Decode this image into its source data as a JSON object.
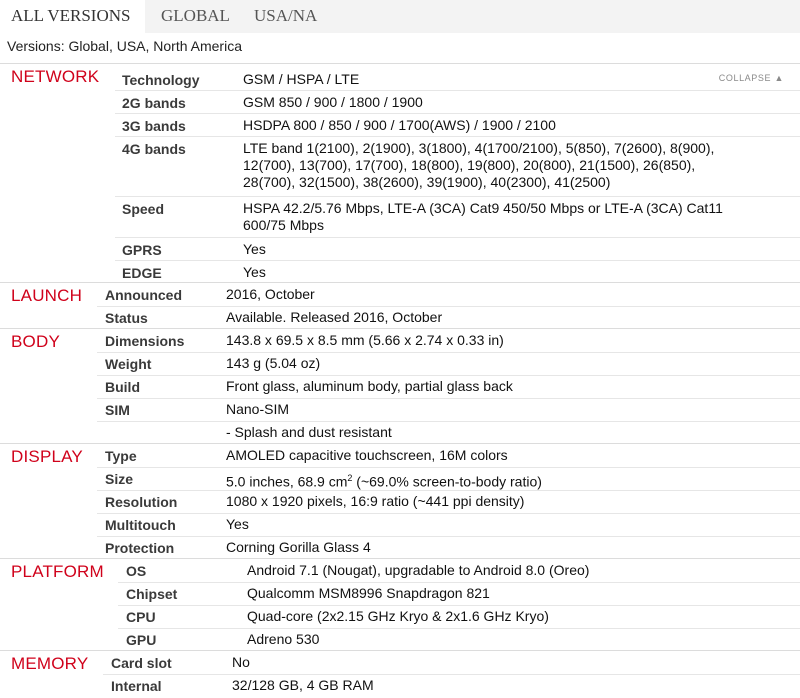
{
  "tabs": [
    {
      "label": "ALL VERSIONS",
      "active": true
    },
    {
      "label": "GLOBAL",
      "active": false
    },
    {
      "label": "USA/NA",
      "active": false
    }
  ],
  "versions_text": "Versions: Global, USA, North America",
  "collapse_label": "COLLAPSE",
  "collapse_icon": "triangle-up-icon",
  "accent_color": "#d0021b",
  "network": {
    "title": "NETWORK",
    "technology": {
      "label": "Technology",
      "value": "GSM / HSPA / LTE"
    },
    "bands2g": {
      "label": "2G bands",
      "value": "GSM 850 / 900 / 1800 / 1900"
    },
    "bands3g": {
      "label": "3G bands",
      "value": "HSDPA 800 / 850 / 900 / 1700(AWS) / 1900 / 2100"
    },
    "bands4g": {
      "label": "4G bands",
      "line1": "LTE band 1(2100), 2(1900), 3(1800), 4(1700/2100), 5(850), 7(2600), 8(900),",
      "line2": "12(700), 13(700), 17(700), 18(800), 19(800), 20(800), 21(1500), 26(850),",
      "line3": "28(700), 32(1500), 38(2600), 39(1900), 40(2300), 41(2500)"
    },
    "speed": {
      "label": "Speed",
      "line1": "HSPA 42.2/5.76 Mbps, LTE-A (3CA) Cat9 450/50 Mbps or LTE-A (3CA) Cat11",
      "line2": "600/75 Mbps"
    },
    "gprs": {
      "label": "GPRS",
      "value": "Yes"
    },
    "edge": {
      "label": "EDGE",
      "value": "Yes"
    }
  },
  "launch": {
    "title": "LAUNCH",
    "announced": {
      "label": "Announced",
      "value": "2016, October"
    },
    "status": {
      "label": "Status",
      "value": "Available. Released 2016, October"
    }
  },
  "body": {
    "title": "BODY",
    "dimensions": {
      "label": "Dimensions",
      "value": "143.8 x 69.5 x 8.5 mm (5.66 x 2.74 x 0.33 in)"
    },
    "weight": {
      "label": "Weight",
      "value": "143 g (5.04 oz)"
    },
    "build": {
      "label": "Build",
      "value": "Front glass, aluminum body, partial glass back"
    },
    "sim": {
      "label": "SIM",
      "value": "Nano-SIM"
    },
    "extra": {
      "value": "- Splash and dust resistant"
    }
  },
  "display": {
    "title": "DISPLAY",
    "type": {
      "label": "Type",
      "value": "AMOLED capacitive touchscreen, 16M colors"
    },
    "size": {
      "label": "Size",
      "value_pre": "5.0 inches, 68.9 cm",
      "value_sup": "2",
      "value_post": " (~69.0% screen-to-body ratio)"
    },
    "resolution": {
      "label": "Resolution",
      "value": "1080 x 1920 pixels, 16:9 ratio (~441 ppi density)"
    },
    "multitouch": {
      "label": "Multitouch",
      "value": "Yes"
    },
    "protection": {
      "label": "Protection",
      "value": "Corning Gorilla Glass 4"
    }
  },
  "platform": {
    "title": "PLATFORM",
    "os": {
      "label": "OS",
      "value": "Android 7.1 (Nougat), upgradable to Android 8.0 (Oreo)"
    },
    "chipset": {
      "label": "Chipset",
      "value": "Qualcomm MSM8996 Snapdragon 821"
    },
    "cpu": {
      "label": "CPU",
      "value": "Quad-core (2x2.15 GHz Kryo & 2x1.6 GHz Kryo)"
    },
    "gpu": {
      "label": "GPU",
      "value": "Adreno 530"
    }
  },
  "memory": {
    "title": "MEMORY",
    "cardslot": {
      "label": "Card slot",
      "value": "No"
    },
    "internal": {
      "label": "Internal",
      "value": "32/128 GB, 4 GB RAM"
    }
  }
}
